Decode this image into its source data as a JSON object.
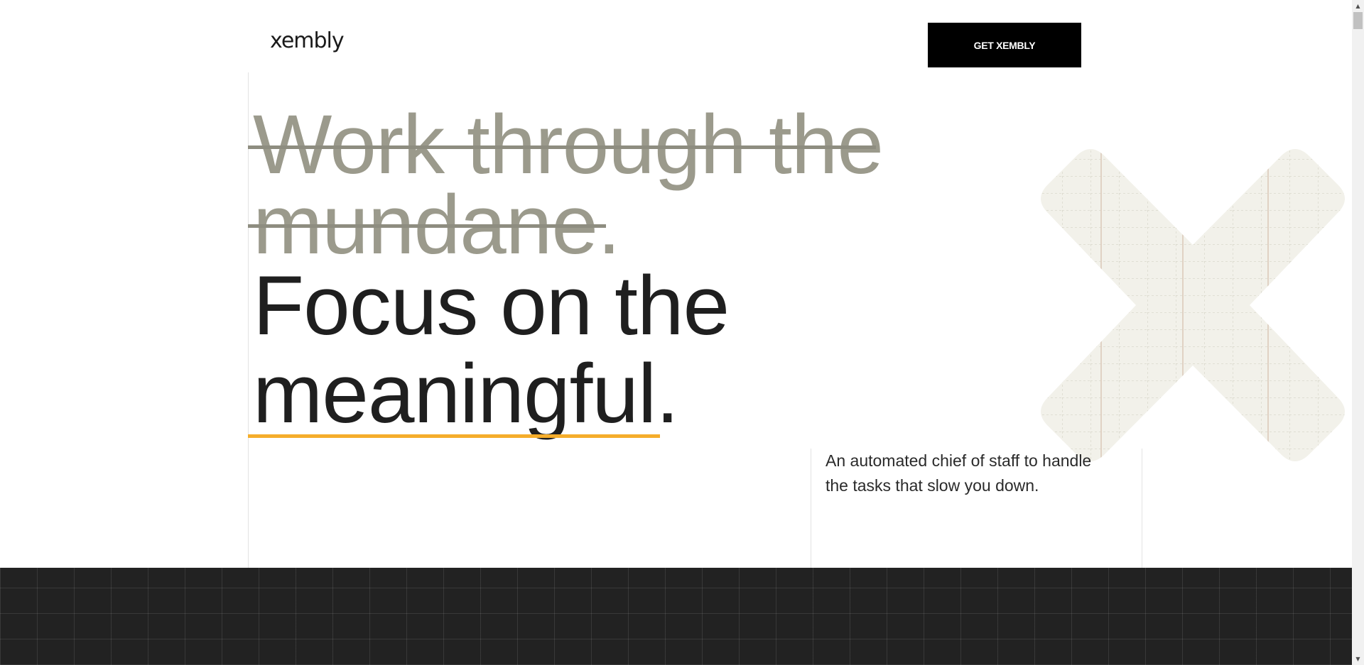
{
  "header": {
    "logo_text": "xembly",
    "cta_label": "GET XEMBLY"
  },
  "hero": {
    "struck_line_1": "Work through the",
    "struck_line_2": "mundane.",
    "focus_line_1": "Focus on the",
    "focus_line_2": "meaningful."
  },
  "subtext": {
    "line_1": "An automated chief of staff to handle",
    "line_2": "the tasks that slow you down."
  },
  "colors": {
    "struck_text": "#9b9a8c",
    "accent_underline": "#f5ad2b",
    "cta_background": "#000000",
    "dark_band": "#222222",
    "x_decoration": "#f2f1ea"
  },
  "icons": {
    "decoration": "x-mark-icon",
    "scroll_up": "triangle-up-icon",
    "scroll_down": "triangle-down-icon"
  }
}
